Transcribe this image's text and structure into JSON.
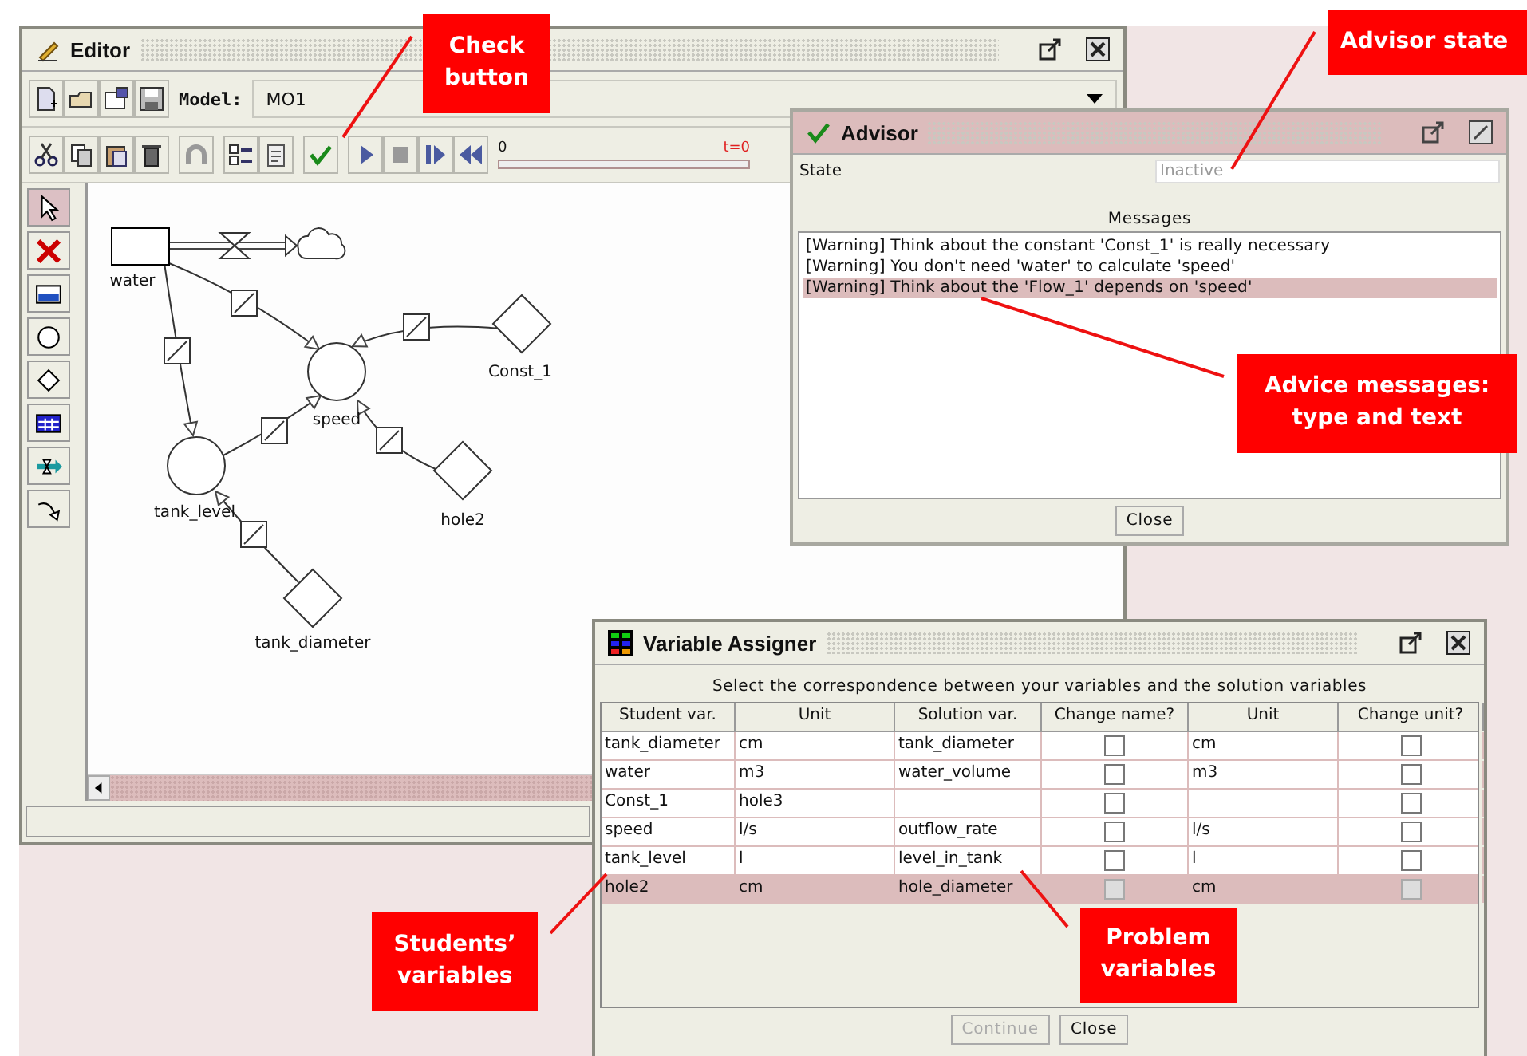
{
  "editor": {
    "title": "Editor",
    "model_label": "Model:",
    "model_value": "MO1",
    "time_start": "0",
    "time_label": "t=0",
    "time_slider": {
      "level": 0
    },
    "tools": [
      {
        "kind": "pointer",
        "selected": true
      },
      {
        "kind": "delete",
        "selected": false
      },
      {
        "kind": "stock",
        "selected": false
      },
      {
        "kind": "auxiliary",
        "selected": false
      },
      {
        "kind": "constant",
        "selected": false
      },
      {
        "kind": "table",
        "selected": false
      },
      {
        "kind": "flow",
        "selected": false
      },
      {
        "kind": "connector",
        "selected": false
      }
    ],
    "nodes": [
      {
        "kind": "stock",
        "label": "water"
      },
      {
        "kind": "cloud"
      },
      {
        "kind": "auxiliary",
        "label": "speed"
      },
      {
        "kind": "constant",
        "label": "Const_1"
      },
      {
        "kind": "auxiliary",
        "label": "tank_level"
      },
      {
        "kind": "constant",
        "label": "hole2"
      },
      {
        "kind": "constant",
        "label": "tank_diameter"
      }
    ]
  },
  "advisor": {
    "title": "Advisor",
    "state_label": "State",
    "state_value": "Inactive",
    "messages_label": "Messages",
    "messages": [
      {
        "text": "[Warning] Think about the constant 'Const_1' is really necessary",
        "selected": false
      },
      {
        "text": "[Warning] You don't need 'water' to calculate 'speed'",
        "selected": false
      },
      {
        "text": "[Warning] Think about the 'Flow_1' depends on 'speed'",
        "selected": true
      }
    ],
    "close": "Close"
  },
  "assigner": {
    "title": "Variable Assigner",
    "instruction": "Select the correspondence between your variables and the solution variables",
    "columns": [
      "Student var.",
      "Unit",
      "Solution var.",
      "Change name?",
      "Unit",
      "Change unit?"
    ],
    "rows": [
      {
        "student_var": "tank_diameter",
        "unit": "cm",
        "solution_var": "tank_diameter",
        "change_name": false,
        "solution_unit": "cm",
        "change_unit": false,
        "selected": false
      },
      {
        "student_var": "water",
        "unit": "m3",
        "solution_var": "water_volume",
        "change_name": false,
        "solution_unit": "m3",
        "change_unit": false,
        "selected": false
      },
      {
        "student_var": "Const_1",
        "unit": "hole3",
        "change_name": false,
        "change_unit": false,
        "selected": false
      },
      {
        "student_var": "speed",
        "unit": "l/s",
        "solution_var": "outflow_rate",
        "change_name": false,
        "solution_unit": "l/s",
        "change_unit": false,
        "selected": false
      },
      {
        "student_var": "tank_level",
        "unit": "l",
        "solution_var": "level_in_tank",
        "change_name": false,
        "solution_unit": "l",
        "change_unit": false,
        "selected": false
      },
      {
        "student_var": "hole2",
        "unit": "cm",
        "solution_var": "hole_diameter",
        "change_name": false,
        "solution_unit": "cm",
        "change_unit": false,
        "selected": true
      }
    ],
    "buttons": [
      {
        "label": "Continue",
        "disabled": true
      },
      {
        "label": "Close",
        "disabled": false
      }
    ]
  },
  "callouts": [
    {
      "text": "Check button"
    },
    {
      "text": "Advisor state"
    },
    {
      "text": "Advice messages: type and text"
    },
    {
      "text": "Students’ variables"
    },
    {
      "text": "Problem variables"
    }
  ]
}
